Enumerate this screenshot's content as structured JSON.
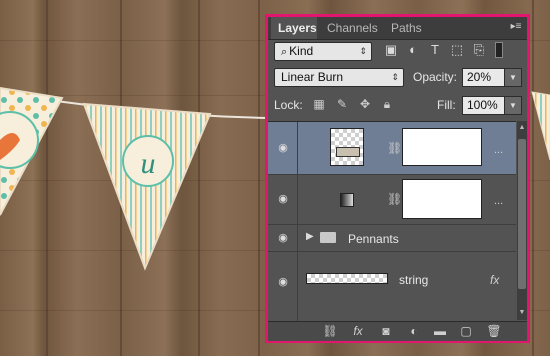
{
  "panel": {
    "tabs": [
      {
        "label": "Layers",
        "active": true
      },
      {
        "label": "Channels",
        "active": false
      },
      {
        "label": "Paths",
        "active": false
      }
    ],
    "filter": {
      "value": "Kind",
      "search_icon": "search-icon"
    },
    "filter_icons": [
      "image-filter-icon",
      "adjustment-filter-icon",
      "type-filter-icon",
      "shape-filter-icon",
      "smart-object-filter-icon",
      "filter-toggle-icon"
    ],
    "blend_mode": "Linear Burn",
    "opacity": {
      "label": "Opacity:",
      "value": "20%"
    },
    "lock": {
      "label": "Lock:",
      "icons": [
        "lock-transparent-icon",
        "lock-image-icon",
        "lock-position-icon",
        "lock-all-icon"
      ]
    },
    "fill": {
      "label": "Fill:",
      "value": "100%"
    },
    "layers": [
      {
        "name": "",
        "type": "adjustment-with-mask",
        "selected": true,
        "visible": true
      },
      {
        "name": "",
        "type": "gradient-with-mask",
        "selected": false,
        "visible": true
      },
      {
        "name": "Pennants",
        "type": "group",
        "selected": false,
        "visible": true
      },
      {
        "name": "string",
        "type": "layer-with-fx",
        "selected": false,
        "visible": true,
        "fx": "fx"
      }
    ],
    "bottom_icons": [
      "link-layers-icon",
      "add-style-icon",
      "add-mask-icon",
      "new-adjustment-icon",
      "new-group-icon",
      "new-layer-icon",
      "delete-layer-icon"
    ],
    "bottom_fx_label": "fx",
    "colors": {
      "accent_border": "#e2166f",
      "selected_row": "#6f7d95",
      "panel": "#535353"
    }
  },
  "canvas": {
    "pennant_letter": "u"
  }
}
